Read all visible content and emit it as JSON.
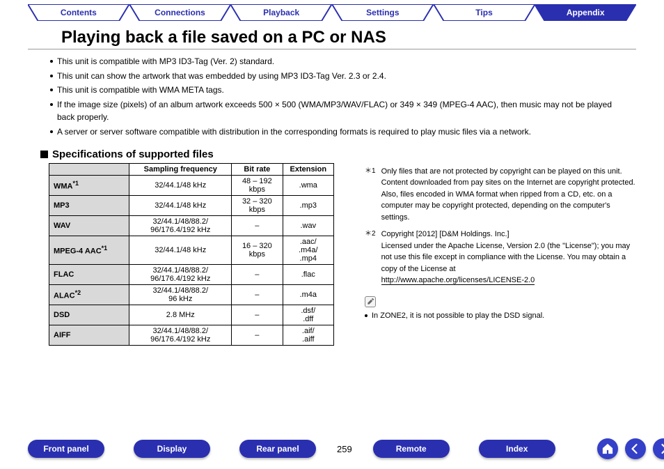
{
  "topTabs": [
    {
      "label": "Contents",
      "active": false
    },
    {
      "label": "Connections",
      "active": false
    },
    {
      "label": "Playback",
      "active": false
    },
    {
      "label": "Settings",
      "active": false
    },
    {
      "label": "Tips",
      "active": false
    },
    {
      "label": "Appendix",
      "active": true
    }
  ],
  "pageTitle": "Playing back a file saved on a PC or NAS",
  "introBullets": [
    "This unit is compatible with MP3 ID3-Tag (Ver. 2) standard.",
    "This unit can show the artwork that was embedded by using MP3 ID3-Tag Ver. 2.3 or 2.4.",
    "This unit is compatible with WMA META tags.",
    "If the image size (pixels) of an album artwork exceeds 500 × 500 (WMA/MP3/WAV/FLAC) or 349 × 349 (MPEG-4 AAC), then music may not be played back properly.",
    "A server or server software compatible with distribution in the corresponding formats is required to play music files via a network."
  ],
  "sectionHeading": "Specifications of supported files",
  "table": {
    "headers": [
      "",
      "Sampling frequency",
      "Bit rate",
      "Extension"
    ],
    "rows": [
      {
        "name": "WMA",
        "sup": "＊1",
        "sf": "32/44.1/48 kHz",
        "br": "48 – 192\nkbps",
        "ext": ".wma"
      },
      {
        "name": "MP3",
        "sup": "",
        "sf": "32/44.1/48 kHz",
        "br": "32 – 320\nkbps",
        "ext": ".mp3"
      },
      {
        "name": "WAV",
        "sup": "",
        "sf": "32/44.1/48/88.2/\n96/176.4/192 kHz",
        "br": "–",
        "ext": ".wav"
      },
      {
        "name": "MPEG-4 AAC",
        "sup": "＊1",
        "sf": "32/44.1/48 kHz",
        "br": "16 – 320\nkbps",
        "ext": ".aac/\n.m4a/\n.mp4"
      },
      {
        "name": "FLAC",
        "sup": "",
        "sf": "32/44.1/48/88.2/\n96/176.4/192 kHz",
        "br": "–",
        "ext": ".flac"
      },
      {
        "name": "ALAC",
        "sup": "＊2",
        "sf": "32/44.1/48/88.2/\n96 kHz",
        "br": "–",
        "ext": ".m4a"
      },
      {
        "name": "DSD",
        "sup": "",
        "sf": "2.8 MHz",
        "br": "–",
        "ext": ".dsf/\n.dff"
      },
      {
        "name": "AIFF",
        "sup": "",
        "sf": "32/44.1/48/88.2/\n96/176.4/192 kHz",
        "br": "–",
        "ext": ".aif/\n.aiff"
      }
    ]
  },
  "footnotes": {
    "n1": {
      "tag": "＊1",
      "text": "Only files that are not protected by copyright can be played on this unit.\nContent downloaded from pay sites on the Internet are copyright protected. Also, files encoded in WMA format when ripped from a CD, etc. on a computer may be copyright protected, depending on the computer's settings."
    },
    "n2": {
      "tag": "＊2",
      "text_before": "Copyright [2012] [D&M Holdings. Inc.]\nLicensed under the Apache License, Version 2.0 (the \"License\"); you may not use this file except in compliance with the License. You may obtain a copy of the License at",
      "link": "http://www.apache.org/licenses/LICENSE-2.0"
    },
    "zoneNote": "In ZONE2, it is not possible to play the DSD signal."
  },
  "bottom": {
    "buttons": [
      "Front panel",
      "Display",
      "Rear panel"
    ],
    "buttons2": [
      "Remote",
      "Index"
    ],
    "pageNumber": "259"
  }
}
